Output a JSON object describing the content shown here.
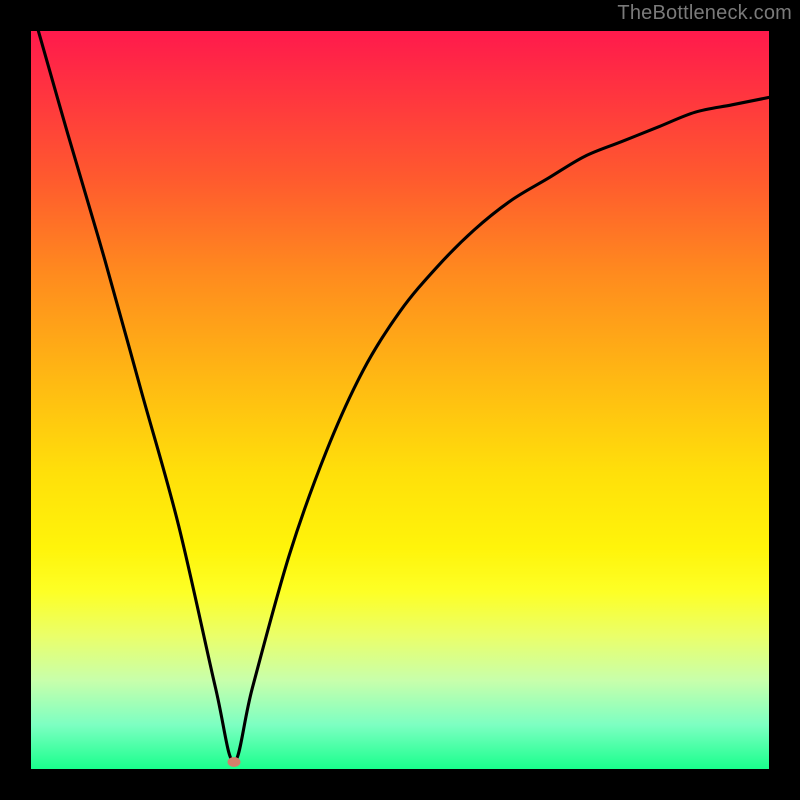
{
  "watermark": "TheBottleneck.com",
  "colors": {
    "background": "#000000",
    "curve_stroke": "#000000",
    "marker_fill": "#d47f6b",
    "watermark_color": "#7a7a7a"
  },
  "chart_data": {
    "type": "line",
    "title": "",
    "xlabel": "",
    "ylabel": "",
    "xlim": [
      0,
      100
    ],
    "ylim": [
      0,
      100
    ],
    "grid": false,
    "legend": false,
    "note": "Values estimated from the plotted curve; chart has no visible axis ticks.",
    "background_gradient": "vertical red (top) through orange/yellow to green (bottom)",
    "marker": {
      "x": 27.5,
      "y": 1,
      "color": "#d47f6b"
    },
    "series": [
      {
        "name": "bottleneck-curve",
        "color": "#000000",
        "x": [
          1,
          5,
          10,
          15,
          20,
          25,
          27.5,
          30,
          35,
          40,
          45,
          50,
          55,
          60,
          65,
          70,
          75,
          80,
          85,
          90,
          95,
          100
        ],
        "y": [
          100,
          86,
          69,
          51,
          33,
          11,
          1,
          11,
          29,
          43,
          54,
          62,
          68,
          73,
          77,
          80,
          83,
          85,
          87,
          89,
          90,
          91
        ]
      }
    ]
  }
}
